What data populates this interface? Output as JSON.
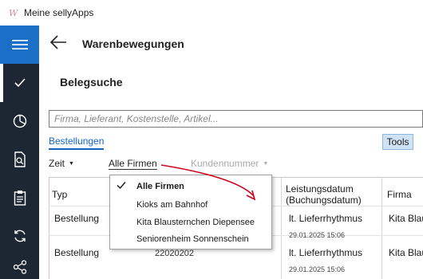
{
  "window": {
    "title": "Meine sellyApps",
    "icon": "sellyapps-logo-icon"
  },
  "sidebar": {
    "items": [
      {
        "name": "hamburger-menu",
        "icon": "menu-icon"
      },
      {
        "name": "check",
        "icon": "check-icon"
      },
      {
        "name": "statistics",
        "icon": "pie-chart-icon"
      },
      {
        "name": "document-search",
        "icon": "document-search-icon"
      },
      {
        "name": "clipboard",
        "icon": "clipboard-icon"
      },
      {
        "name": "sync",
        "icon": "sync-icon"
      },
      {
        "name": "share",
        "icon": "share-icon"
      }
    ],
    "active_color": "#1a6fc7",
    "background": "#1c2733"
  },
  "header": {
    "title": "Warenbewegungen"
  },
  "section": {
    "title": "Belegsuche"
  },
  "search": {
    "placeholder": "Firma, Lieferant, Kostenstelle, Artikel...",
    "value": ""
  },
  "tabs": [
    {
      "label": "Bestellungen",
      "active": true
    }
  ],
  "toolbar": {
    "tools_label": "Tools"
  },
  "filters": {
    "zeit": "Zeit",
    "firmen": "Alle Firmen",
    "kundennummer": "Kundennummer"
  },
  "table": {
    "columns": {
      "typ": "Typ",
      "leistungsdatum_line1": "Leistungsdatum",
      "leistungsdatum_line2": "(Buchungsdatum)",
      "firma": "Firma"
    },
    "rows": [
      {
        "typ": "Bestellung",
        "leistung": "lt. Lieferrhythmus",
        "datum": "29.01.2025 15:06",
        "firma": "Kita Blau"
      },
      {
        "typ": "Bestellung",
        "nummer": "22020202",
        "leistung": "lt. Lieferrhythmus",
        "datum": "29.01.2025 15:06",
        "firma": "Kita Blau"
      }
    ]
  },
  "dropdown": {
    "items": [
      {
        "label": "Alle Firmen",
        "selected": true
      },
      {
        "label": "Kioks am Bahnhof",
        "selected": false
      },
      {
        "label": "Kita Blausternchen Diepensee",
        "selected": false
      },
      {
        "label": "Seniorenheim Sonnenschein",
        "selected": false
      }
    ]
  },
  "colors": {
    "accent": "#1565c0",
    "tools_bg": "#cfe3f5",
    "annotation": "#d0021b"
  }
}
